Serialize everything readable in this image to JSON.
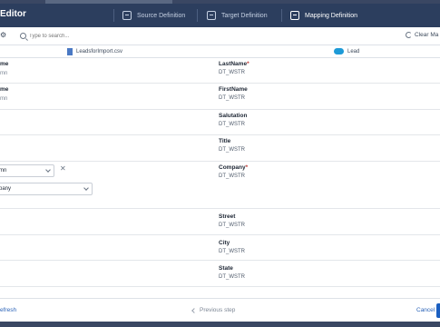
{
  "header": {
    "title": "Editor",
    "steps": [
      {
        "label": "Source Definition",
        "icon": "source-icon"
      },
      {
        "label": "Target Definition",
        "icon": "target-icon"
      },
      {
        "label": "Mapping Definition",
        "icon": "mapping-icon"
      }
    ]
  },
  "toolbar": {
    "search_placeholder": "Type to search...",
    "clear_label": "Clear Ma"
  },
  "sources": {
    "file_name": "LeadsforImport.csv",
    "target_name": "Lead"
  },
  "rows": [
    {
      "left_name": "me",
      "left_sub": "mn",
      "right_name": "LastName",
      "required": true,
      "right_type": "DT_WSTR"
    },
    {
      "left_name": "me",
      "left_sub": "mn",
      "right_name": "FirstName",
      "required": false,
      "right_type": "DT_WSTR"
    },
    {
      "left_name": "",
      "left_sub": "",
      "right_name": "Salutation",
      "required": false,
      "right_type": "DT_WSTR"
    },
    {
      "left_name": "",
      "left_sub": "",
      "right_name": "Title",
      "required": false,
      "right_type": "DT_WSTR"
    },
    {
      "left_select": "mn",
      "left_select2": "pany",
      "right_name": "Company",
      "required": true,
      "right_type": "DT_WSTR"
    },
    {
      "left_name": "",
      "left_sub": "",
      "right_name": "Street",
      "required": false,
      "right_type": "DT_WSTR"
    },
    {
      "left_name": "",
      "left_sub": "",
      "right_name": "City",
      "required": false,
      "right_type": "DT_WSTR"
    },
    {
      "left_name": "",
      "left_sub": "",
      "right_name": "State",
      "required": false,
      "right_type": "DT_WSTR"
    }
  ],
  "footer": {
    "refresh_label": "efresh",
    "prev_label": "Previous step",
    "cancel_label": "Cancel"
  },
  "colors": {
    "header_bg": "#2c3e5e",
    "accent": "#1b5fc1",
    "required": "#c23934"
  }
}
